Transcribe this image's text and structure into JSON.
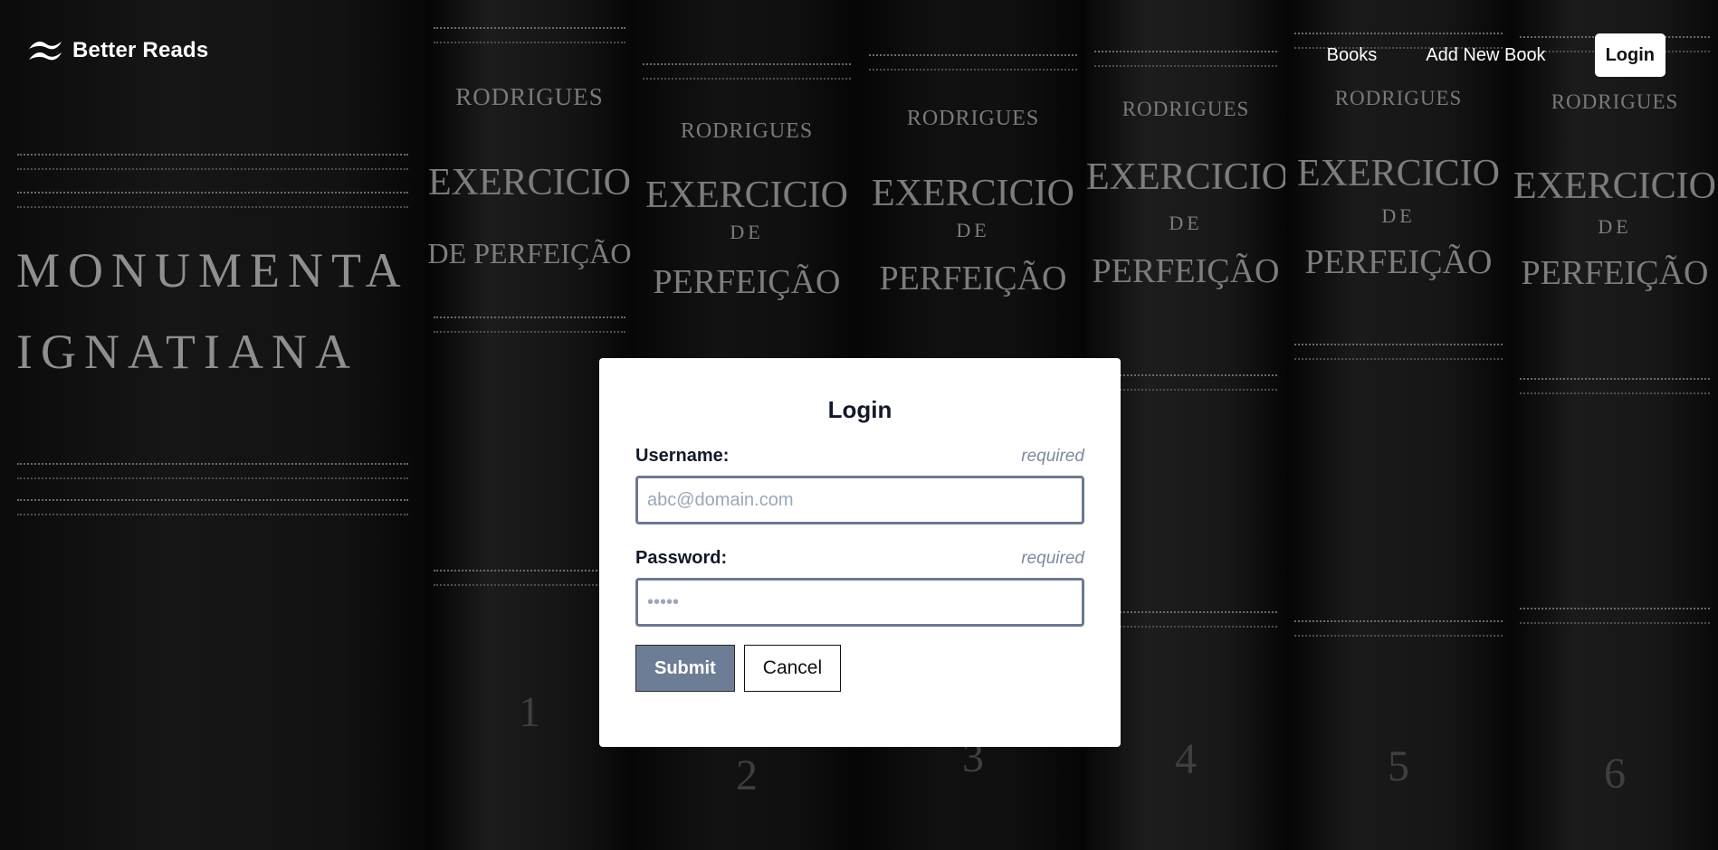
{
  "navbar": {
    "brand": {
      "name": "Better Reads",
      "icon": "wave-logo-icon"
    },
    "links": [
      {
        "label": "Books"
      },
      {
        "label": "Add New Book"
      }
    ],
    "login_label": "Login"
  },
  "background": {
    "books": [
      {
        "text": [
          "MONUMENTA",
          "IGNATIANA"
        ]
      },
      {
        "author": "RODRIGUES",
        "title": [
          "EXERCICIO",
          "DE PERFEIÇÃO"
        ],
        "volume": "1"
      },
      {
        "author": "RODRIGUES",
        "title": [
          "EXERCICIO",
          "DE",
          "PERFEIÇÃO"
        ],
        "volume": "2"
      },
      {
        "author": "RODRIGUES",
        "title": [
          "EXERCICIO",
          "DE",
          "PERFEIÇÃO"
        ],
        "volume": "3"
      },
      {
        "author": "RODRIGUES",
        "title": [
          "EXERCICIO",
          "DE",
          "PERFEIÇÃO"
        ],
        "volume": "4"
      },
      {
        "author": "RODRIGUES",
        "title": [
          "EXERCICIO",
          "DE",
          "PERFEIÇÃO"
        ],
        "volume": "5"
      },
      {
        "author": "RODRIGUES",
        "title": [
          "EXERCICIO",
          "DE",
          "PERFEIÇÃO"
        ],
        "volume": "6"
      }
    ]
  },
  "login_form": {
    "title": "Login",
    "username": {
      "label": "Username:",
      "required_text": "required",
      "placeholder": "abc@domain.com",
      "value": ""
    },
    "password": {
      "label": "Password:",
      "required_text": "required",
      "placeholder": "•••••",
      "value": ""
    },
    "submit_label": "Submit",
    "cancel_label": "Cancel"
  },
  "colors": {
    "submit_button": "#6e7d96",
    "input_border": "#6b7a90",
    "background": "#050505"
  }
}
